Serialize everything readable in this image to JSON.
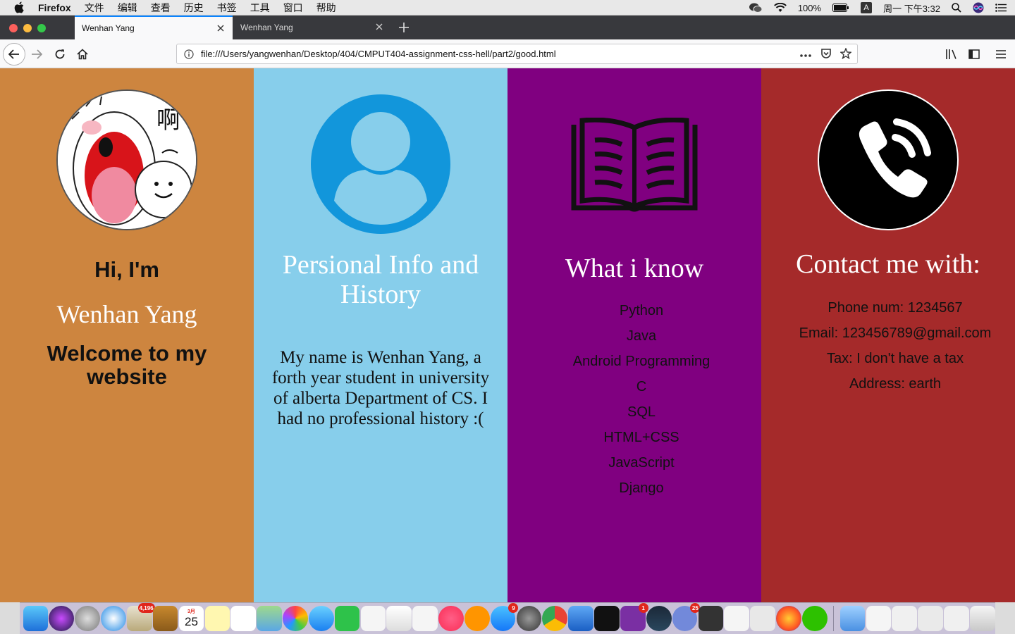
{
  "menubar": {
    "app": "Firefox",
    "items": [
      "文件",
      "编辑",
      "查看",
      "历史",
      "书签",
      "工具",
      "窗口",
      "帮助"
    ],
    "battery": "100%",
    "input_method": "A",
    "clock": "周一 下午3:32"
  },
  "tabs": [
    {
      "title": "Wenhan Yang",
      "active": true
    },
    {
      "title": "Wenhan Yang",
      "active": false
    }
  ],
  "navbar": {
    "url": "file:///Users/yangwenhan/Desktop/404/CMPUT404-assignment-css-hell/part2/good.html"
  },
  "page": {
    "intro": {
      "hi": "Hi, I'm",
      "name": "Wenhan Yang",
      "welcome": "Welcome to my website",
      "avatar_text": "啊"
    },
    "info": {
      "title": "Persional Info and History",
      "text": "My name is Wenhan Yang, a forth year student in university of alberta Department of CS. I had no professional history :("
    },
    "skills": {
      "title": "What i know",
      "items": [
        "Python",
        "Java",
        "Android Programming",
        "C",
        "SQL",
        "HTML+CSS",
        "JavaScript",
        "Django"
      ]
    },
    "contact": {
      "title": "Contact me with:",
      "items": [
        "Phone num: 1234567",
        "Email: 123456789@gmail.com",
        "Tax: I don't have a tax",
        "Address: earth"
      ]
    }
  },
  "dock": {
    "badges": {
      "mail": "4,196",
      "calendar_day": "25",
      "calendar_month": "3月",
      "appstore": "9",
      "onenote": "1",
      "discord": "25"
    },
    "colors": {
      "column1": "#cd853f",
      "column2": "#87ceeb",
      "column3": "#800080",
      "column4": "#a52a2a",
      "accent_blue": "#0a84ff"
    }
  }
}
